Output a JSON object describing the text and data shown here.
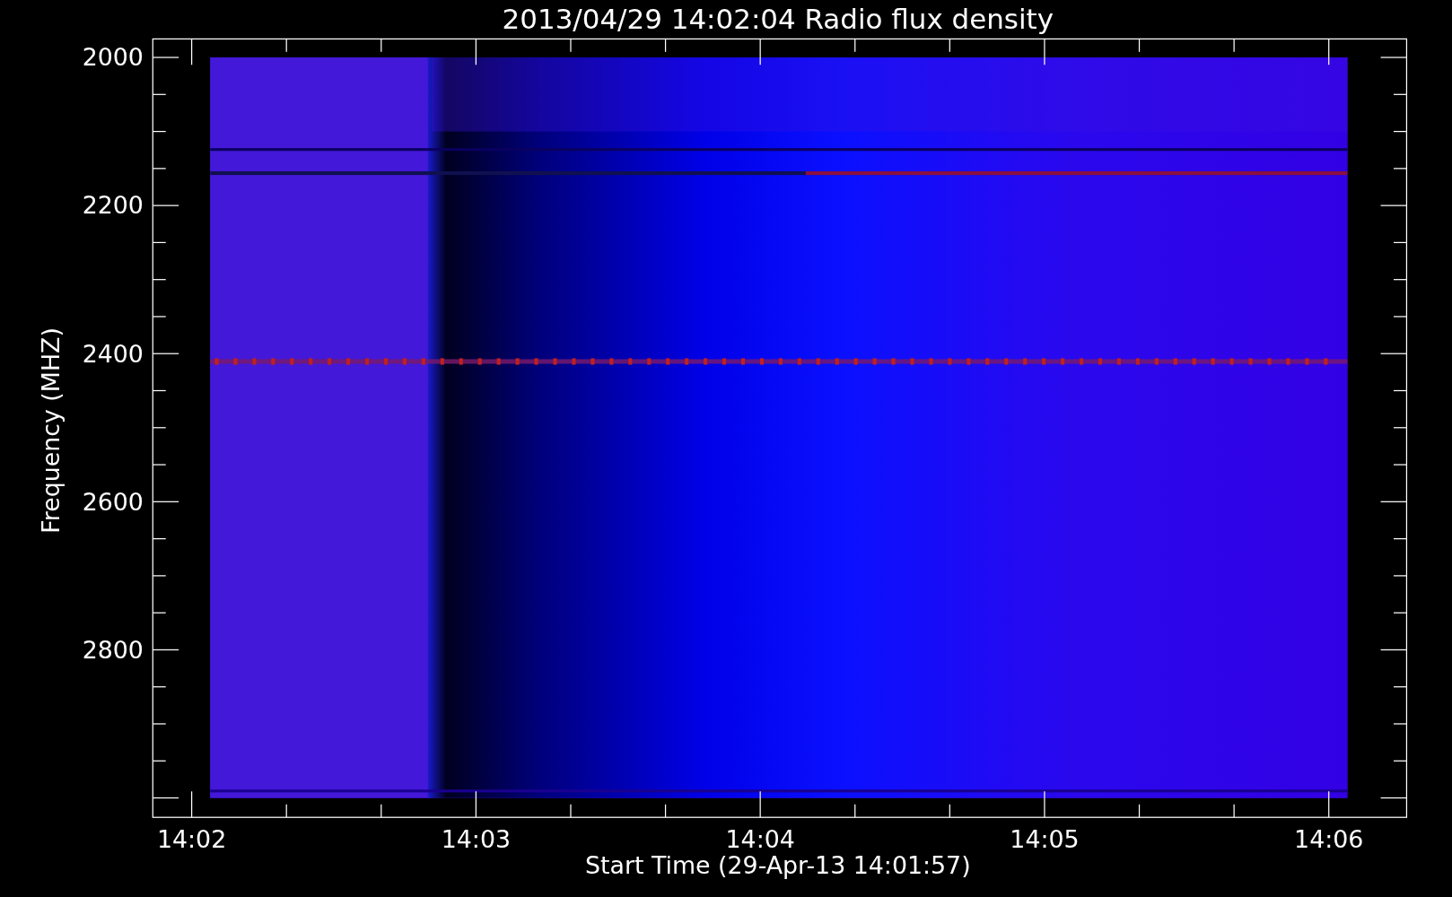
{
  "title": "2013/04/29 14:02:04 Radio flux density",
  "ylabel": "Frequency (MHZ)",
  "xlabel": "Start Time (29-Apr-13 14:01:57)",
  "yticks": [
    "2000",
    "2200",
    "2400",
    "2600",
    "2800"
  ],
  "xticks": [
    "14:02",
    "14:03",
    "14:04",
    "14:05",
    "14:06"
  ]
}
